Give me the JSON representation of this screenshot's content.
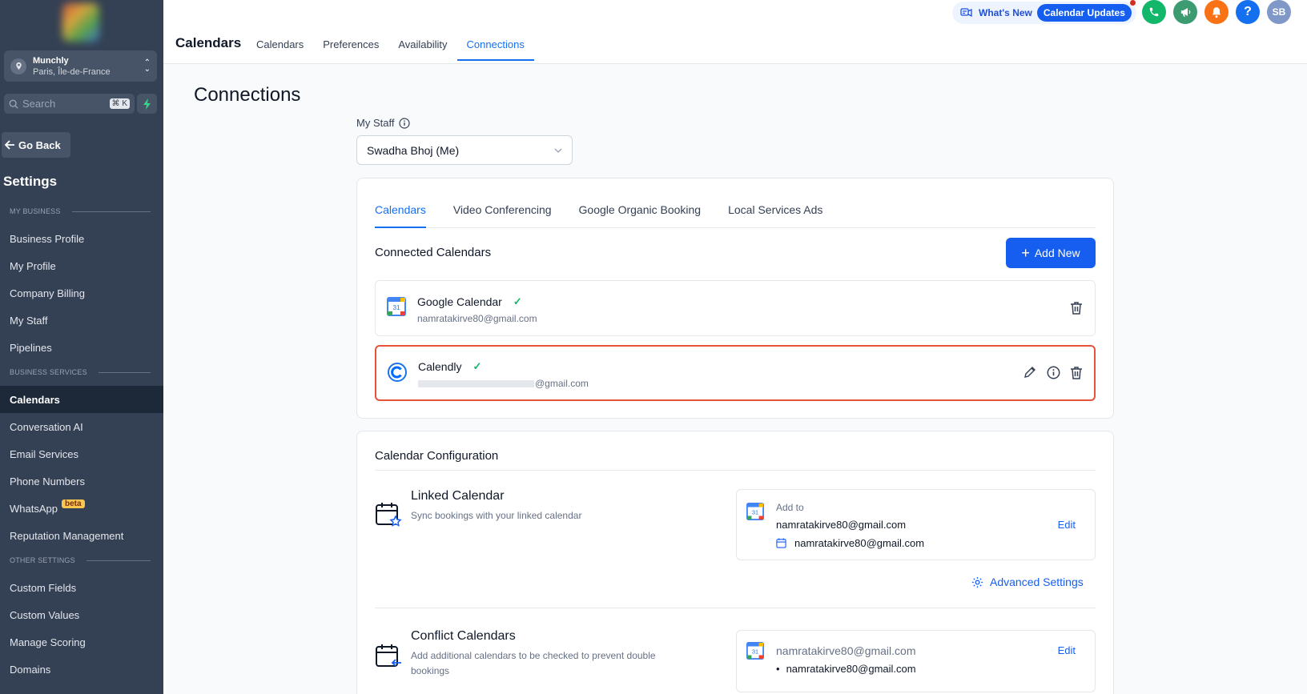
{
  "sidebar": {
    "location": {
      "name": "Munchly",
      "address": "Paris, Île-de-France"
    },
    "search": {
      "placeholder": "Search",
      "shortcut": "⌘ K"
    },
    "go_back": "Go Back",
    "title": "Settings",
    "sections": [
      {
        "label": "MY BUSINESS",
        "items": [
          "Business Profile",
          "My Profile",
          "Company Billing",
          "My Staff",
          "Pipelines"
        ]
      },
      {
        "label": "BUSINESS SERVICES",
        "items": [
          "Calendars",
          "Conversation AI",
          "Email Services",
          "Phone Numbers",
          "WhatsApp",
          "Reputation Management"
        ]
      },
      {
        "label": "OTHER SETTINGS",
        "items": [
          "Custom Fields",
          "Custom Values",
          "Manage Scoring",
          "Domains"
        ]
      }
    ],
    "active_item": "Calendars",
    "whatsapp_badge": "beta"
  },
  "header": {
    "title": "Calendars",
    "tabs": [
      "Calendars",
      "Preferences",
      "Availability",
      "Connections"
    ],
    "active_tab": "Connections",
    "whats_new": "What's New",
    "calendar_updates": "Calendar Updates",
    "avatar_initials": "SB",
    "icons": [
      "phone-icon",
      "megaphone-icon",
      "bell-icon",
      "help-icon"
    ],
    "colors": {
      "phone": "#12b76a",
      "megaphone": "#3d9b72",
      "bell": "#f97316",
      "help": "#1570ef",
      "accent": "#155eef"
    }
  },
  "main": {
    "page_title": "Connections",
    "staff_label": "My Staff",
    "staff_value": "Swadha Bhoj (Me)",
    "inner_tabs": [
      "Calendars",
      "Video Conferencing",
      "Google Organic Booking",
      "Local Services Ads"
    ],
    "active_inner_tab": "Calendars",
    "connected_title": "Connected Calendars",
    "add_new": "Add New",
    "connections": [
      {
        "name": "Google Calendar",
        "email": "namratakirve80@gmail.com",
        "icon": "google-calendar-icon"
      },
      {
        "name": "Calendly",
        "email": "@gmail.com",
        "icon": "calendly-icon"
      }
    ],
    "config": {
      "title": "Calendar Configuration",
      "linked": {
        "title": "Linked Calendar",
        "subtitle": "Sync bookings with your linked calendar",
        "add_to_label": "Add to",
        "account": "namratakirve80@gmail.com",
        "calendar": "namratakirve80@gmail.com",
        "edit": "Edit"
      },
      "advanced": "Advanced Settings",
      "conflict": {
        "title": "Conflict Calendars",
        "subtitle": "Add additional calendars to be checked to prevent double bookings",
        "account": "namratakirve80@gmail.com",
        "calendar": "namratakirve80@gmail.com",
        "edit": "Edit"
      }
    }
  }
}
